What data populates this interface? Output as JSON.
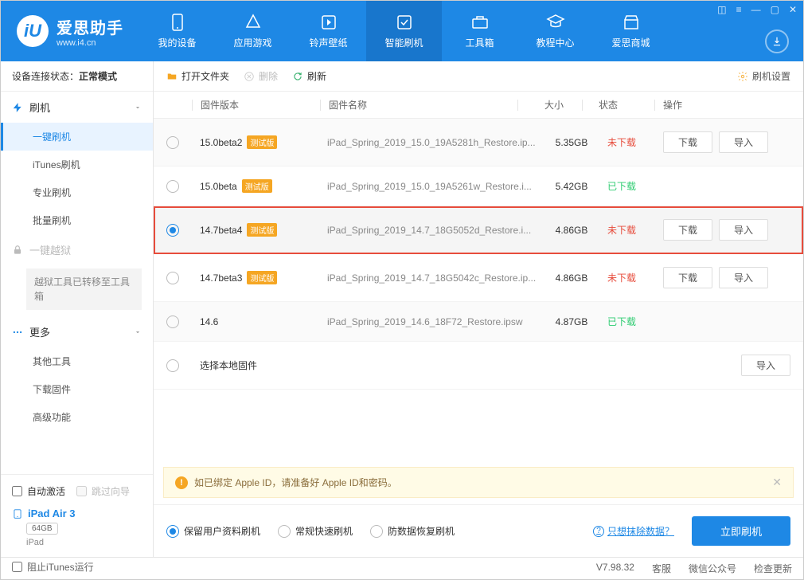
{
  "brand": {
    "id_text": "iU",
    "title": "爱思助手",
    "sub": "www.i4.cn"
  },
  "nav": {
    "items": [
      {
        "label": "我的设备"
      },
      {
        "label": "应用游戏"
      },
      {
        "label": "铃声壁纸"
      },
      {
        "label": "智能刷机"
      },
      {
        "label": "工具箱"
      },
      {
        "label": "教程中心"
      },
      {
        "label": "爱思商城"
      }
    ]
  },
  "sidebar": {
    "status_label": "设备连接状态：",
    "status_value": "正常模式",
    "flash_header": "刷机",
    "flash_subs": [
      "一键刷机",
      "iTunes刷机",
      "专业刷机",
      "批量刷机"
    ],
    "jailbreak_header": "一键越狱",
    "jailbreak_note": "越狱工具已转移至工具箱",
    "more_header": "更多",
    "more_subs": [
      "其他工具",
      "下载固件",
      "高级功能"
    ],
    "auto_activate": "自动激活",
    "skip_guide": "跳过向导",
    "device_name": "iPad Air 3",
    "device_cap": "64GB",
    "device_type": "iPad"
  },
  "toolbar": {
    "open_folder": "打开文件夹",
    "delete": "删除",
    "refresh": "刷新",
    "settings": "刷机设置"
  },
  "columns": {
    "version": "固件版本",
    "name": "固件名称",
    "size": "大小",
    "status": "状态",
    "ops": "操作"
  },
  "beta_tag": "测试版",
  "btn_download": "下载",
  "btn_import": "导入",
  "status_not_dl": "未下载",
  "status_dl": "已下载",
  "rows": [
    {
      "ver": "15.0beta2",
      "beta": true,
      "name": "iPad_Spring_2019_15.0_19A5281h_Restore.ip...",
      "size": "5.35GB",
      "status": "not_dl",
      "ops": [
        "dl",
        "imp"
      ],
      "selected": false
    },
    {
      "ver": "15.0beta",
      "beta": true,
      "name": "iPad_Spring_2019_15.0_19A5261w_Restore.i...",
      "size": "5.42GB",
      "status": "dl",
      "ops": [],
      "selected": false
    },
    {
      "ver": "14.7beta4",
      "beta": true,
      "name": "iPad_Spring_2019_14.7_18G5052d_Restore.i...",
      "size": "4.86GB",
      "status": "not_dl",
      "ops": [
        "dl",
        "imp"
      ],
      "selected": true
    },
    {
      "ver": "14.7beta3",
      "beta": true,
      "name": "iPad_Spring_2019_14.7_18G5042c_Restore.ip...",
      "size": "4.86GB",
      "status": "not_dl",
      "ops": [
        "dl",
        "imp"
      ],
      "selected": false
    },
    {
      "ver": "14.6",
      "beta": false,
      "name": "iPad_Spring_2019_14.6_18F72_Restore.ipsw",
      "size": "4.87GB",
      "status": "dl",
      "ops": [],
      "selected": false
    }
  ],
  "local_row_label": "选择本地固件",
  "alert_text": "如已绑定 Apple ID，请准备好 Apple ID和密码。",
  "action_opts": [
    "保留用户资料刷机",
    "常规快速刷机",
    "防数据恢复刷机"
  ],
  "erase_link": "只想抹除数据？",
  "flash_now": "立即刷机",
  "statusbar": {
    "block_itunes": "阻止iTunes运行",
    "version": "V7.98.32",
    "kefu": "客服",
    "wechat": "微信公众号",
    "update": "检查更新"
  }
}
